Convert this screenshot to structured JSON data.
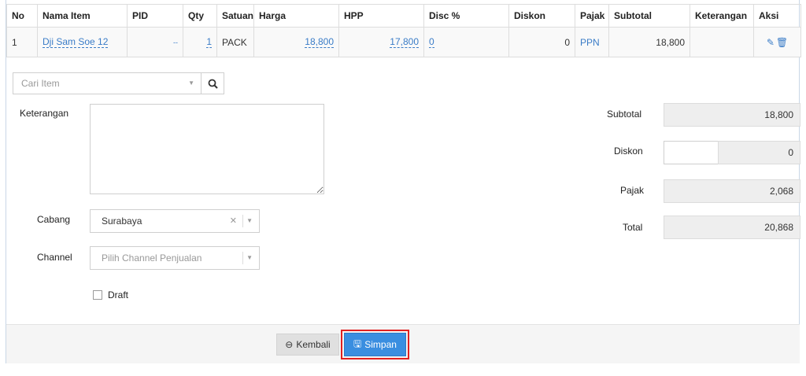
{
  "table": {
    "headers": {
      "no": "No",
      "nama": "Nama Item",
      "pid": "PID",
      "qty": "Qty",
      "satuan": "Satuan",
      "harga": "Harga",
      "hpp": "HPP",
      "disc": "Disc %",
      "diskon": "Diskon",
      "pajak": "Pajak",
      "subtotal": "Subtotal",
      "keterangan": "Keterangan",
      "aksi": "Aksi"
    },
    "rows": [
      {
        "no": "1",
        "nama": "Dji Sam Soe 12",
        "pid": "--",
        "qty": "1",
        "satuan": "PACK",
        "harga": "18,800",
        "hpp": "17,800",
        "disc": "0",
        "diskon": "0",
        "pajak": "PPN",
        "subtotal": "18,800",
        "keterangan": ""
      }
    ]
  },
  "search": {
    "placeholder": "Cari Item"
  },
  "form": {
    "keterangan_label": "Keterangan",
    "cabang_label": "Cabang",
    "cabang_value": "Surabaya",
    "channel_label": "Channel",
    "channel_placeholder": "Pilih Channel Penjualan",
    "draft_label": "Draft"
  },
  "summary": {
    "subtotal_label": "Subtotal",
    "subtotal_value": "18,800",
    "diskon_label": "Diskon",
    "diskon_value": "0",
    "pajak_label": "Pajak",
    "pajak_value": "2,068",
    "total_label": "Total",
    "total_value": "20,868"
  },
  "footer": {
    "back_label": "Kembali",
    "save_label": "Simpan"
  },
  "colors": {
    "link": "#3a7cc7",
    "primary": "#3a8ee0",
    "highlight": "#e02020"
  }
}
